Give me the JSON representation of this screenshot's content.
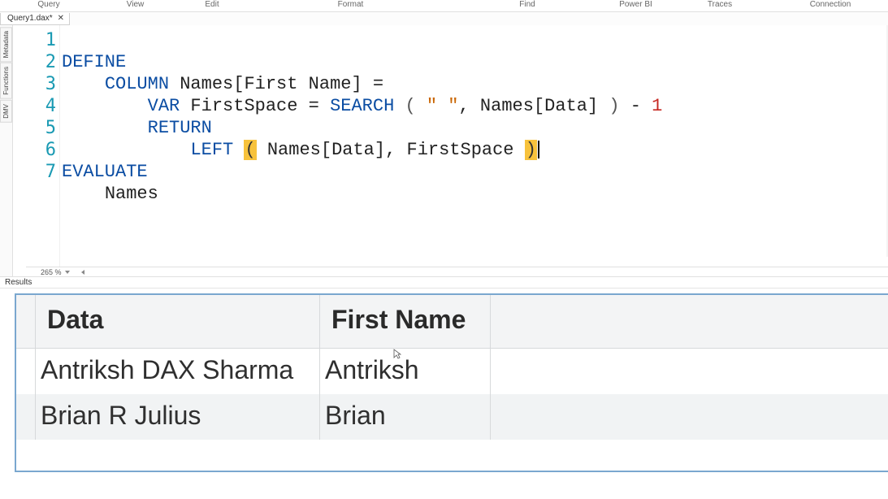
{
  "menubar": {
    "items": [
      "Query",
      "View",
      "Edit",
      "Format",
      "Find",
      "Power BI",
      "Traces",
      "Connection"
    ],
    "widths": [
      120,
      93,
      96,
      245,
      190,
      77,
      130,
      142
    ]
  },
  "tab": {
    "label": "Query1.dax*",
    "close": "✕"
  },
  "side_tabs": [
    "Metadata",
    "Functions",
    "DMV"
  ],
  "code": {
    "line_count": 7,
    "lines": {
      "l1": "DEFINE",
      "l2_kw": "COLUMN",
      "l2_txt": " Names[First Name] =",
      "l3_kw": "VAR",
      "l3_a": " FirstSpace = ",
      "l3_fn": "SEARCH",
      "l3_p1": " ( ",
      "l3_str": "\" \"",
      "l3_mid": ", Names[Data] ",
      "l3_p2": ")",
      "l3_minus": " - ",
      "l3_num": "1",
      "l4_kw": "RETURN",
      "l5_fn": "LEFT",
      "l5_sp": " ",
      "l5_open": "(",
      "l5_args": " Names[Data], FirstSpace ",
      "l5_close": ")",
      "l6_kw": "EVALUATE",
      "l7_txt": "Names"
    }
  },
  "zoom": {
    "pct": "265 %"
  },
  "results": {
    "label": "Results",
    "headers": [
      "Data",
      "First Name"
    ],
    "rows": [
      {
        "data": "Antriksh DAX Sharma",
        "first": "Antriksh"
      },
      {
        "data": "Brian R Julius",
        "first": "Brian"
      }
    ]
  }
}
